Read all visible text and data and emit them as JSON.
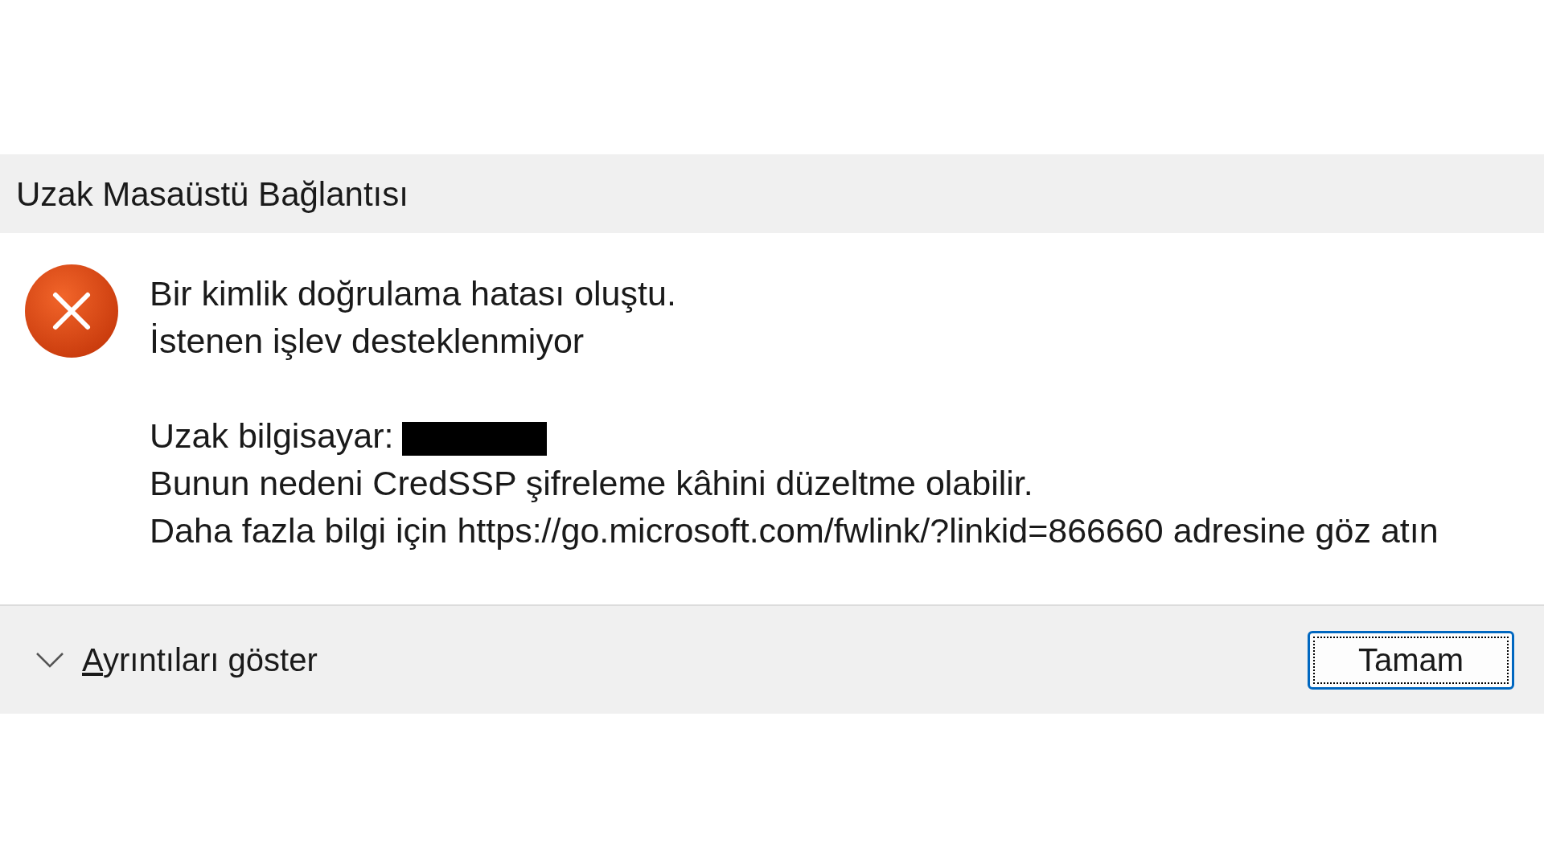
{
  "window": {
    "title": "Uzak Masaüstü Bağlantısı"
  },
  "message": {
    "lines": [
      {
        "kind": "text",
        "text": "Bir kimlik doğrulama hatası oluştu.",
        "redacted": false
      },
      {
        "kind": "text",
        "text": "İstenen işlev desteklenmiyor",
        "redacted": false
      },
      {
        "kind": "gap"
      },
      {
        "kind": "text",
        "text": "Uzak bilgisayar:",
        "redacted": true
      },
      {
        "kind": "text",
        "text": "Bunun nedeni CredSSP şifreleme kâhini düzeltme olabilir.",
        "redacted": false
      },
      {
        "kind": "text",
        "text": "Daha fazla bilgi için https://go.microsoft.com/fwlink/?linkid=866660 adresine göz atın",
        "redacted": false
      }
    ]
  },
  "details": {
    "label": "Ayrıntıları göster",
    "expanded": false
  },
  "buttons": [
    {
      "label": "Tamam",
      "focused": true
    }
  ]
}
